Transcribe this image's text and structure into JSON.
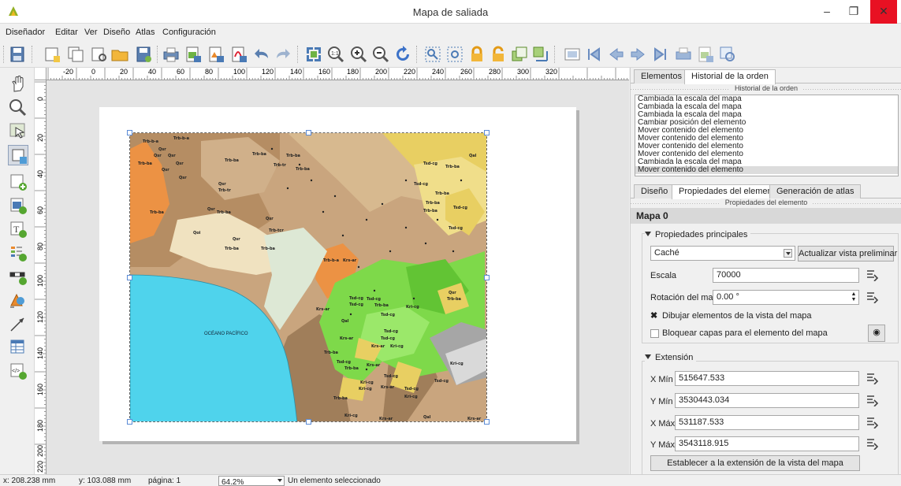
{
  "window": {
    "title": "Mapa de saliada"
  },
  "menu": [
    "Diseñador",
    "Editar",
    "Ver",
    "Diseño",
    "Atlas",
    "Configuración"
  ],
  "ruler": {
    "top_labels": [
      "-20",
      "0",
      "20",
      "40",
      "60",
      "80",
      "100",
      "120",
      "140",
      "160",
      "180",
      "200",
      "220",
      "240",
      "260",
      "280",
      "300",
      "320"
    ],
    "left_labels": [
      "0",
      "20",
      "40",
      "60",
      "80",
      "100",
      "120",
      "140",
      "160",
      "180",
      "200",
      "220"
    ]
  },
  "map": {
    "ocean_label": "OCÉANO PACÍFICO",
    "unit_labels": [
      "Trb-ba",
      "Qsr",
      "Trb-tr",
      "Tsd-cg",
      "Krs-ar",
      "Kri-cg",
      "Qal",
      "Trb-b-a",
      "Qoi",
      "Trb-tcr"
    ]
  },
  "top_panel": {
    "tabs": [
      "Elementos",
      "Historial de la orden"
    ],
    "active_tab": "Historial de la orden",
    "caption": "Historial de la orden",
    "history": [
      "Cambiada la escala del mapa",
      "Cambiada la escala del mapa",
      "Cambiada la escala del mapa",
      "Cambiar posición del elemento",
      "Mover contenido del elemento",
      "Mover contenido del elemento",
      "Mover contenido del elemento",
      "Mover contenido del elemento",
      "Cambiada la escala del mapa",
      "Mover contenido del elemento"
    ]
  },
  "bottom_panel": {
    "tabs": [
      "Diseño",
      "Propiedades del elemento",
      "Generación de atlas"
    ],
    "active_tab": "Propiedades del elemento",
    "caption": "Propiedades del elemento",
    "item_title": "Mapa 0",
    "main_props": {
      "title": "Propiedades principales",
      "cache_option": "Caché",
      "refresh_button": "Actualizar vista preliminar",
      "scale_label": "Escala",
      "scale_value": "70000",
      "rotation_label": "Rotación del mapa",
      "rotation_value": "0.00 °",
      "draw_items_label": "Dibujar elementos de la vista del mapa",
      "draw_items_checked": true,
      "lock_layers_label": "Bloquear capas para el elemento del mapa",
      "lock_layers_checked": false
    },
    "extent": {
      "title": "Extensión",
      "xmin_label": "X Mín",
      "xmin": "515647.533",
      "ymin_label": "Y Mín",
      "ymin": "3530443.034",
      "xmax_label": "X Máx",
      "xmax": "531187.533",
      "ymax_label": "Y Máx",
      "ymax": "3543118.915",
      "set_extent_button": "Establecer a la extensión de la vista del mapa"
    }
  },
  "status": {
    "x": "x: 208.238 mm",
    "y": "y: 103.088 mm",
    "page": "página: 1",
    "zoom": "64.2%",
    "selection": "Un elemento seleccionado"
  },
  "colors": {
    "ocean": "#4fd3ec",
    "brown": "#c9a57e",
    "dark_brown": "#a07e5a",
    "green": "#7ed94a",
    "yellow": "#e8cf62",
    "orange": "#ec9244",
    "close": "#e81123"
  }
}
